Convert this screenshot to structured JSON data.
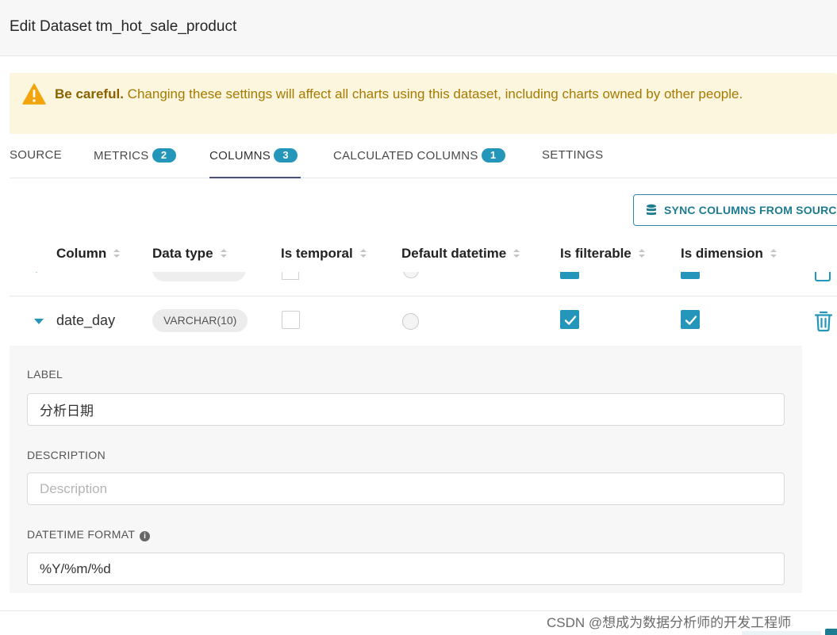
{
  "modal": {
    "title": "Edit Dataset tm_hot_sale_product"
  },
  "warning": {
    "strong": "Be careful.",
    "text": "Changing these settings will affect all charts using this dataset, including charts owned by other people."
  },
  "tabs": [
    {
      "label": "SOURCE",
      "badge": null
    },
    {
      "label": "METRICS",
      "badge": "2"
    },
    {
      "label": "COLUMNS",
      "badge": "3"
    },
    {
      "label": "CALCULATED COLUMNS",
      "badge": "1"
    },
    {
      "label": "SETTINGS",
      "badge": null
    }
  ],
  "toolbar": {
    "sync_label": "SYNC COLUMNS FROM SOURCE"
  },
  "table": {
    "headers": [
      "Column",
      "Data type",
      "Is temporal",
      "Default datetime",
      "Is filterable",
      "Is dimension"
    ]
  },
  "row": {
    "name": "date_day",
    "type": "VARCHAR(10)",
    "is_temporal": false,
    "default_datetime": false,
    "is_filterable": true,
    "is_dimension": true
  },
  "detail": {
    "label_title": "LABEL",
    "label_value": "分析日期",
    "description_title": "DESCRIPTION",
    "description_placeholder": "Description",
    "datetime_title": "DATETIME FORMAT",
    "datetime_value": "%Y/%m/%d"
  },
  "watermark": "CSDN @想成为数据分析师的开发工程师",
  "colors": {
    "accent": "#2396b9",
    "warning_bg": "#fcf6de",
    "tab_underline": "#484e7c"
  }
}
